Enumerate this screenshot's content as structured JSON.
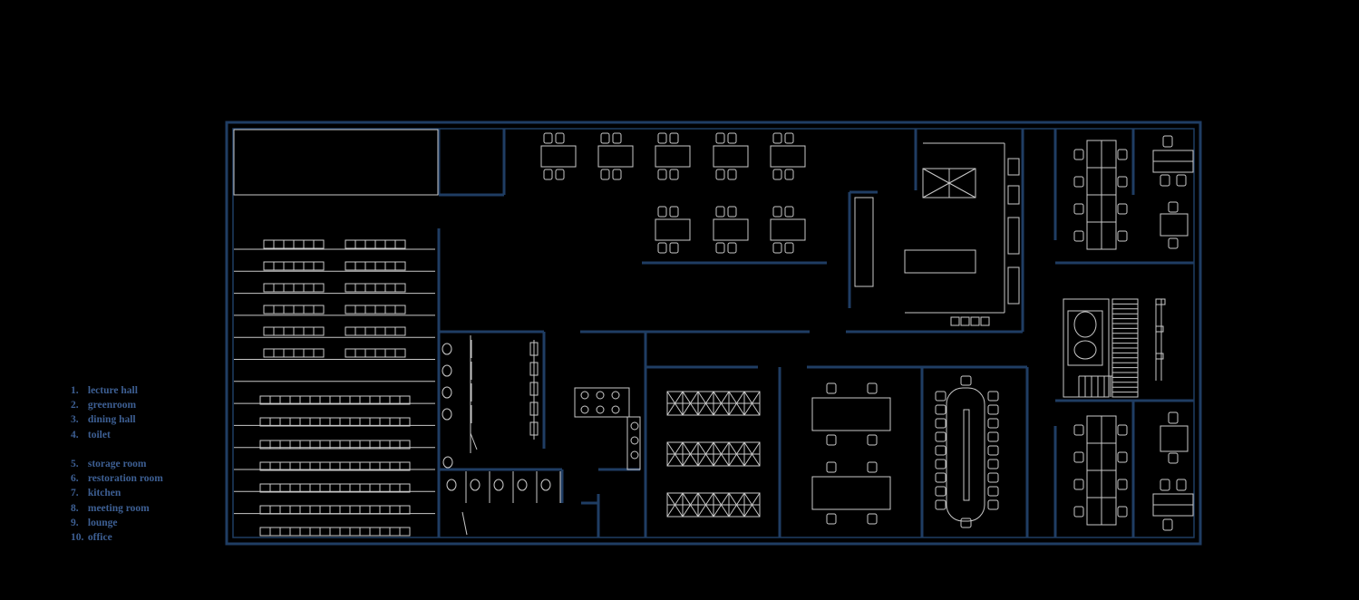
{
  "colors": {
    "background": "#000000",
    "wall": "#1f3d63",
    "furniture": "#c8c8c8",
    "legend_text": "#3d5f93"
  },
  "legend": {
    "items": [
      {
        "num": "1.",
        "label": "lecture hall"
      },
      {
        "num": "2.",
        "label": "greenroom"
      },
      {
        "num": "3.",
        "label": "dining hall"
      },
      {
        "num": "4.",
        "label": "toilet"
      },
      {
        "num": "5.",
        "label": "storage room"
      },
      {
        "num": "6.",
        "label": "restoration room"
      },
      {
        "num": "7.",
        "label": "kitchen"
      },
      {
        "num": "8.",
        "label": "meeting room"
      },
      {
        "num": "9.",
        "label": "lounge"
      },
      {
        "num": "10.",
        "label": "office"
      }
    ]
  }
}
